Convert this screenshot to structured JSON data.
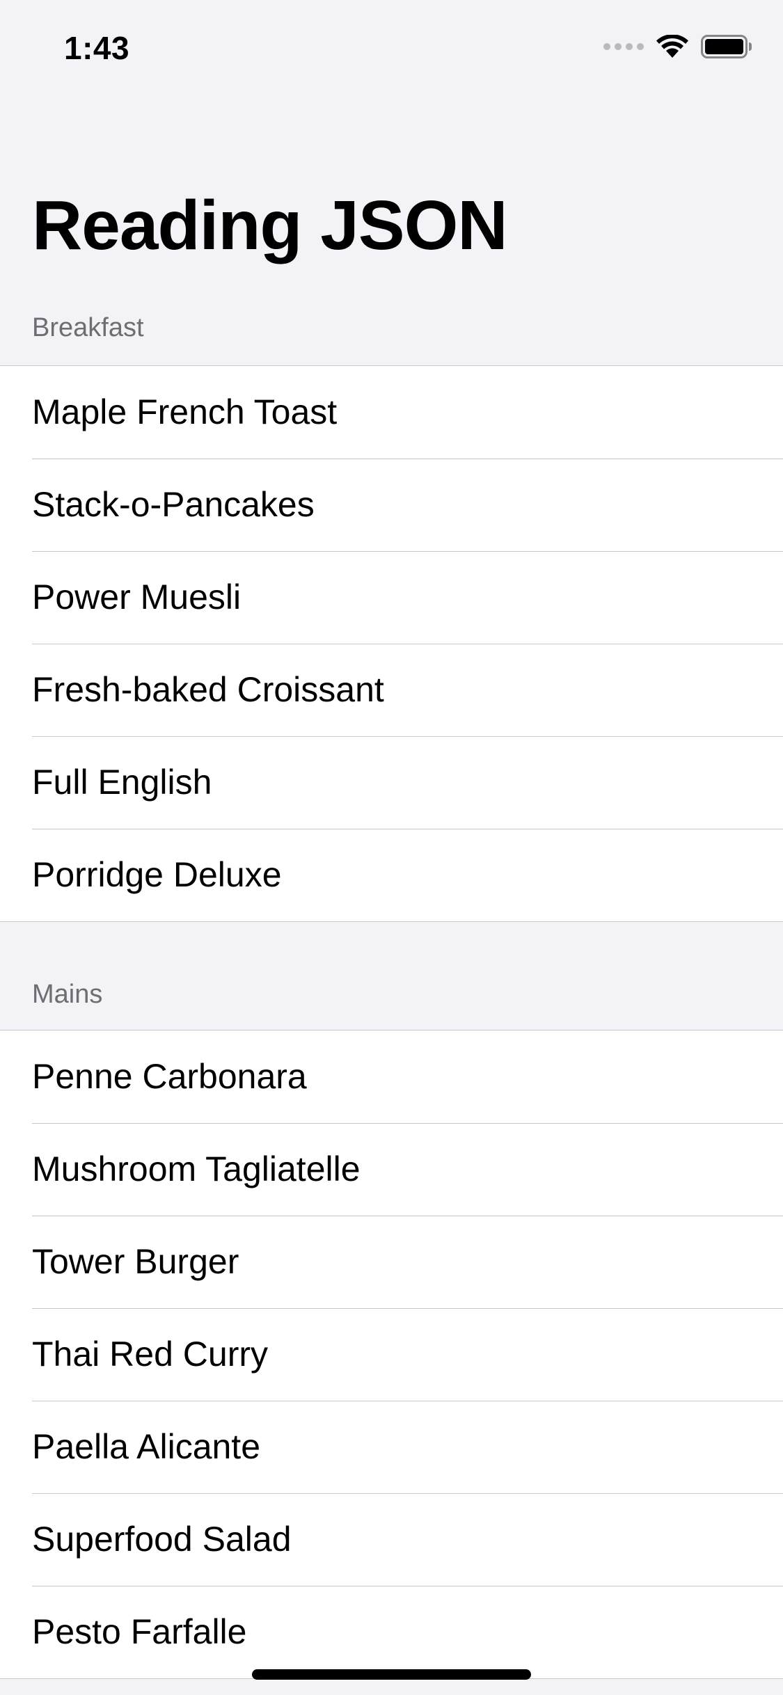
{
  "status_bar": {
    "time": "1:43"
  },
  "navigation": {
    "title": "Reading JSON"
  },
  "sections": [
    {
      "header": "Breakfast",
      "items": [
        "Maple French Toast",
        "Stack-o-Pancakes",
        "Power Muesli",
        "Fresh-baked Croissant",
        "Full English",
        "Porridge Deluxe"
      ]
    },
    {
      "header": "Mains",
      "items": [
        "Penne Carbonara",
        "Mushroom Tagliatelle",
        "Tower Burger",
        "Thai Red Curry",
        "Paella Alicante",
        "Superfood Salad",
        "Pesto Farfalle"
      ]
    }
  ]
}
